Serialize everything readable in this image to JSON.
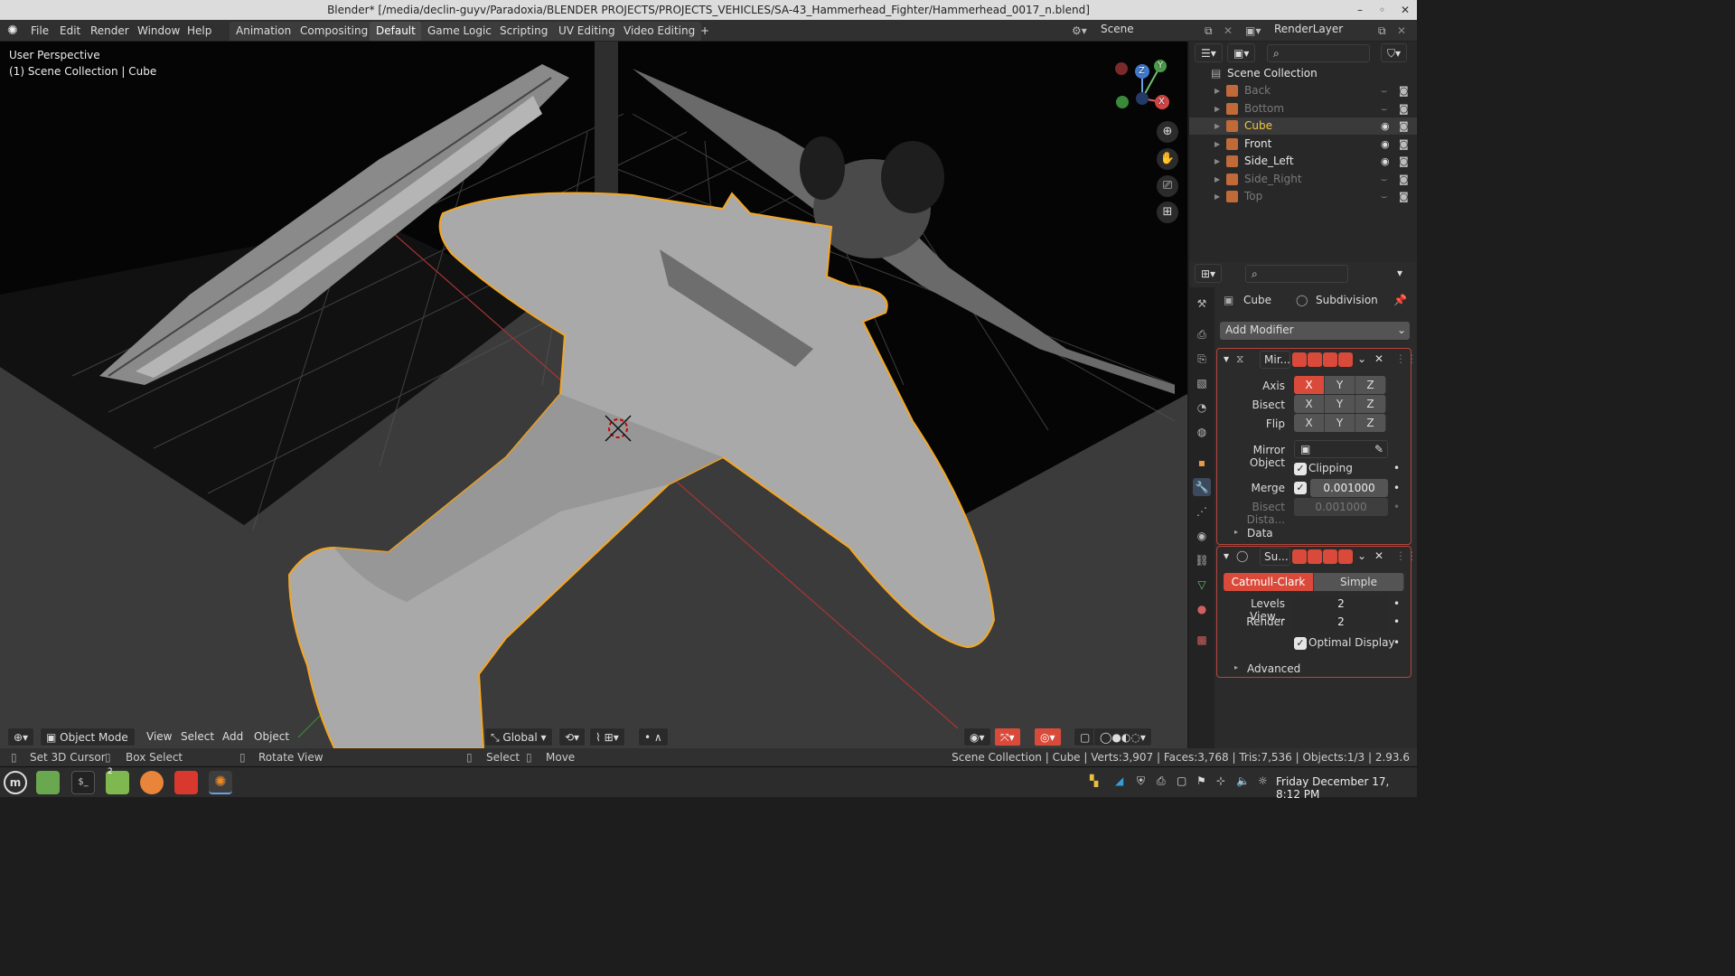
{
  "window": {
    "title": "Blender* [/media/declin-guyv/Paradoxia/BLENDER PROJECTS/PROJECTS_VEHICLES/SA-43_Hammerhead_Fighter/Hammerhead_0017_n.blend]"
  },
  "menu": {
    "file": "File",
    "edit": "Edit",
    "render": "Render",
    "window": "Window",
    "help": "Help"
  },
  "workspaces": [
    "Animation",
    "Compositing",
    "Default",
    "Game Logic",
    "Scripting",
    "UV Editing",
    "Video Editing"
  ],
  "workspace_add": "+",
  "scene": {
    "name": "Scene",
    "render_layer": "RenderLayer"
  },
  "viewport": {
    "perspective": "User Perspective",
    "context": "(1) Scene Collection | Cube",
    "gizmo": {
      "x": "X",
      "y": "Y",
      "z": "Z"
    },
    "header": {
      "mode": "Object Mode",
      "view": "View",
      "select": "Select",
      "add": "Add",
      "object": "Object",
      "orientation": "Global"
    }
  },
  "outliner": {
    "root": "Scene Collection",
    "items": [
      {
        "label": "Back",
        "visible": false,
        "active": false
      },
      {
        "label": "Bottom",
        "visible": false,
        "active": false
      },
      {
        "label": "Cube",
        "visible": true,
        "active": true
      },
      {
        "label": "Front",
        "visible": true,
        "active": false
      },
      {
        "label": "Side_Left",
        "visible": true,
        "active": false
      },
      {
        "label": "Side_Right",
        "visible": false,
        "active": false
      },
      {
        "label": "Top",
        "visible": false,
        "active": false
      }
    ]
  },
  "properties": {
    "object": "Cube",
    "modifier_active": "Subdivision",
    "add_modifier": "Add Modifier",
    "mirror": {
      "name": "Mir...",
      "axis_label": "Axis",
      "bisect_label": "Bisect",
      "flip_label": "Flip",
      "x": "X",
      "y": "Y",
      "z": "Z",
      "mirror_object_label": "Mirror Object",
      "clipping_label": "Clipping",
      "merge_label": "Merge",
      "merge_value": "0.001000",
      "bisect_distance_label": "Bisect Dista...",
      "bisect_distance_value": "0.001000",
      "data_label": "Data"
    },
    "subdivision": {
      "name": "Su...",
      "catmull": "Catmull-Clark",
      "simple": "Simple",
      "levels_label": "Levels View...",
      "levels_value": "2",
      "render_label": "Render",
      "render_value": "2",
      "optimal_label": "Optimal Display",
      "advanced_label": "Advanced"
    }
  },
  "status": {
    "set_cursor": "Set 3D Cursor",
    "box_select": "Box Select",
    "rotate_view": "Rotate View",
    "select": "Select",
    "move": "Move",
    "stats": "Scene Collection | Cube | Verts:3,907 | Faces:3,768 | Tris:7,536 | Objects:1/3 | 2.93.6"
  },
  "taskbar": {
    "datetime": "Friday December 17, 8:12 PM",
    "workspace_badge": "2"
  },
  "colors": {
    "accent_red": "#d94a3a",
    "selection_orange": "#f5a623",
    "active_blue": "#4772b3"
  }
}
